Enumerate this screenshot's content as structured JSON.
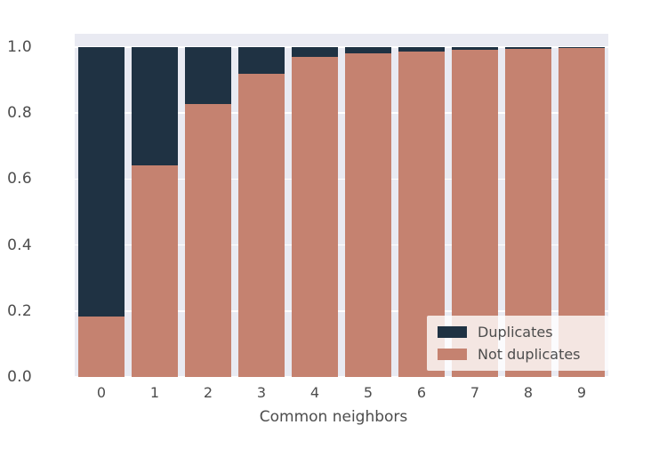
{
  "chart_data": {
    "type": "bar",
    "subtype": "stacked-100-percent",
    "title": "",
    "xlabel": "Common neighbors",
    "ylabel": "",
    "categories": [
      "0",
      "1",
      "2",
      "3",
      "4",
      "5",
      "6",
      "7",
      "8",
      "9"
    ],
    "series": [
      {
        "name": "Not duplicates",
        "color": "#c58270",
        "values": [
          0.183,
          0.641,
          0.827,
          0.919,
          0.97,
          0.981,
          0.987,
          0.992,
          0.995,
          0.996
        ]
      },
      {
        "name": "Duplicates",
        "color": "#1f3243",
        "values": [
          0.817,
          0.359,
          0.173,
          0.081,
          0.03,
          0.019,
          0.013,
          0.008,
          0.005,
          0.004
        ]
      }
    ],
    "stack_order": [
      "Not duplicates",
      "Duplicates"
    ],
    "ylim": [
      0.0,
      1.0
    ],
    "xlim": [
      -0.5,
      9.5
    ],
    "yticks": [
      "0.0",
      "0.2",
      "0.4",
      "0.6",
      "0.8",
      "1.0"
    ],
    "ytick_values": [
      0.0,
      0.2,
      0.4,
      0.6,
      0.8,
      1.0
    ],
    "xticks": [
      "0",
      "1",
      "2",
      "3",
      "4",
      "5",
      "6",
      "7",
      "8",
      "9"
    ],
    "grid": "horizontal-white",
    "legend_position": "lower right",
    "legend_entries": [
      {
        "label": "Duplicates",
        "color": "#1f3243"
      },
      {
        "label": "Not duplicates",
        "color": "#c58270"
      }
    ],
    "style": "seaborn-darkgrid",
    "plot_background": "#e9eaf2",
    "figure_background": "#ffffff",
    "tick_color": "#4d4d4d"
  }
}
